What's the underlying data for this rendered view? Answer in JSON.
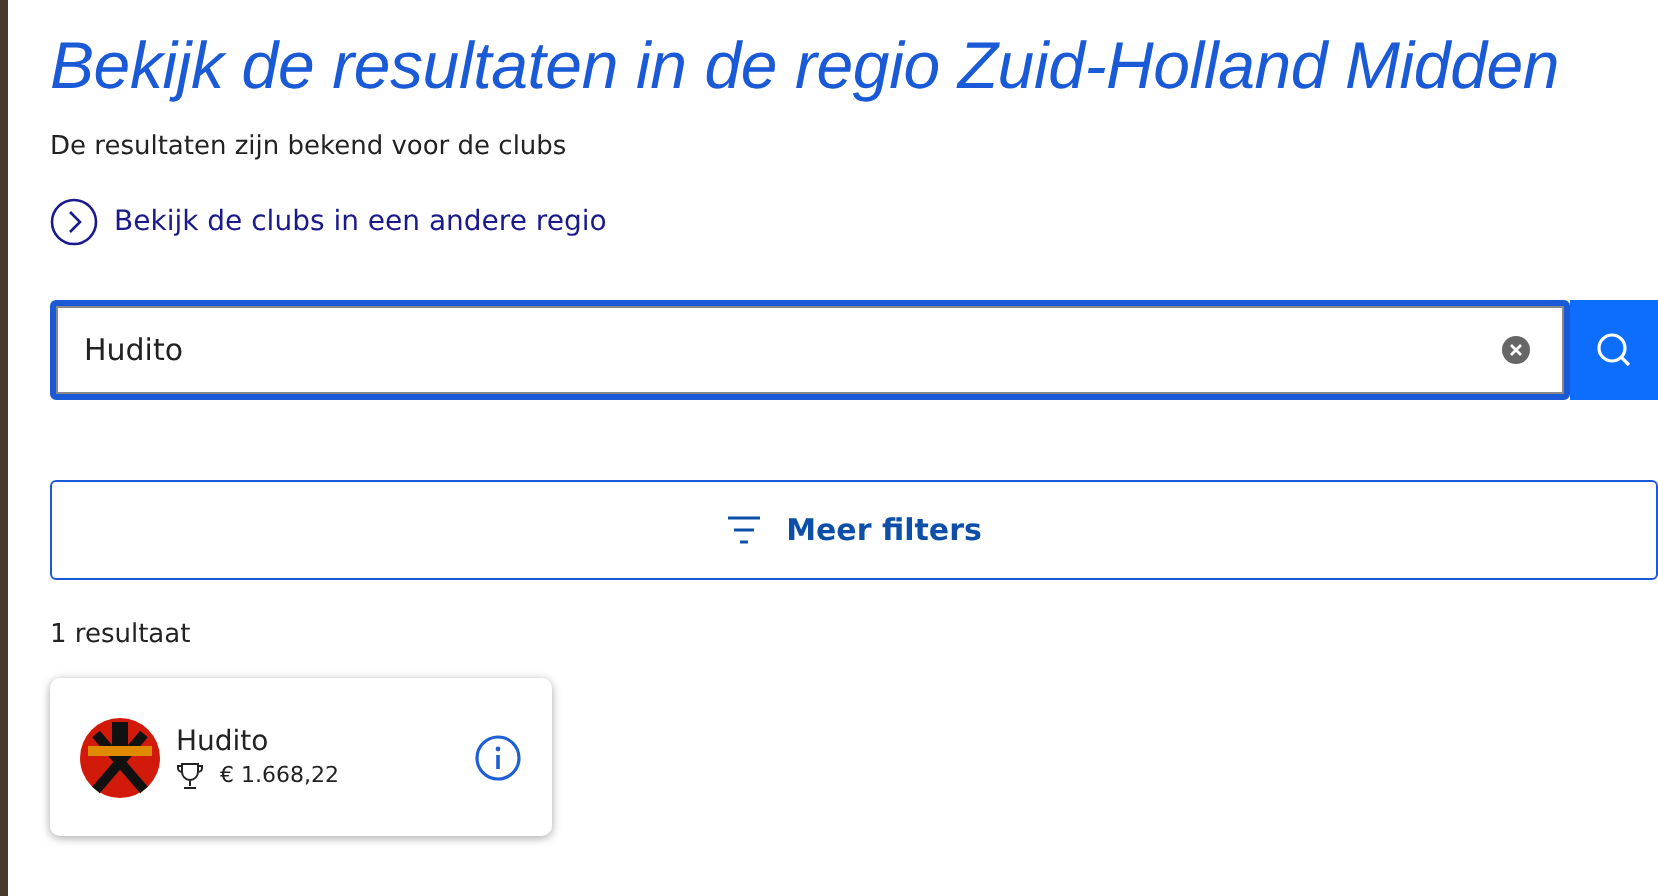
{
  "title": "Bekijk de resultaten in de regio Zuid-Holland Midden",
  "subtitle": "De resultaten zijn bekend voor de clubs",
  "region_link": "Bekijk de clubs in een andere regio",
  "search": {
    "value": "Hudito"
  },
  "filters_button": "Meer filters",
  "result_count": "1 resultaat",
  "results": [
    {
      "name": "Hudito",
      "amount": "€ 1.668,22"
    }
  ]
}
